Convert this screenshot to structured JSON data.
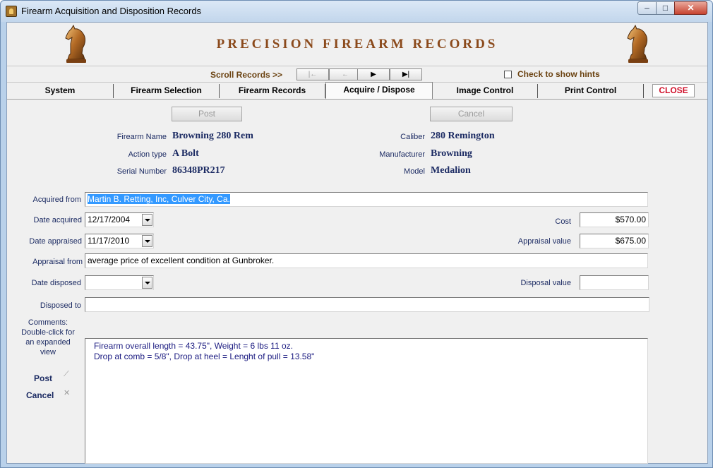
{
  "window": {
    "title": "Firearm Acquisition and Disposition Records",
    "min_glyph": "‒",
    "max_glyph": "□",
    "close_glyph": "✕"
  },
  "header": {
    "brand_title": "PRECISION FIREARM RECORDS",
    "scroll_label": "Scroll  Records >>",
    "nav": {
      "first": "|←",
      "prev": "←",
      "next": "▶",
      "last": "▶|"
    },
    "hints_label": "Check to show hints",
    "hints_checked": false
  },
  "tabs": [
    {
      "label": "System"
    },
    {
      "label": "Firearm Selection"
    },
    {
      "label": "Firearm Records"
    },
    {
      "label": "Acquire / Dispose",
      "active": true
    },
    {
      "label": "Image Control"
    },
    {
      "label": "Print Control"
    }
  ],
  "close_label": "CLOSE",
  "actions": {
    "post": "Post",
    "cancel": "Cancel"
  },
  "firearm": {
    "name_label": "Firearm Name",
    "name": "Browning 280 Rem",
    "action_label": "Action type",
    "action": "A Bolt",
    "serial_label": "Serial Number",
    "serial": "86348PR217",
    "caliber_label": "Caliber",
    "caliber": "280 Remington",
    "manufacturer_label": "Manufacturer",
    "manufacturer": "Browning",
    "model_label": "Model",
    "model": "Medalion"
  },
  "form": {
    "acquired_from_label": "Acquired from",
    "acquired_from": "Martin B. Retting, Inc, Culver City, Ca.",
    "date_acquired_label": "Date acquired",
    "date_acquired": "12/17/2004",
    "cost_label": "Cost",
    "cost": "$570.00",
    "date_appraised_label": "Date appraised",
    "date_appraised": "11/17/2010",
    "appraisal_value_label": "Appraisal value",
    "appraisal_value": "$675.00",
    "appraisal_from_label": "Appraisal from",
    "appraisal_from": "average price of excellent condition at Gunbroker.",
    "date_disposed_label": "Date disposed",
    "date_disposed": "",
    "disposal_value_label": "Disposal value",
    "disposal_value": "",
    "disposed_to_label": "Disposed to",
    "disposed_to": "",
    "comments_label_1": "Comments:",
    "comments_label_2": "Double-click for",
    "comments_label_3": "an expanded",
    "comments_label_4": "view",
    "comments_line_1": "Firearm overall length = 43.75\", Weight = 6 lbs 11 oz.",
    "comments_line_2": "Drop at comb = 5/8\", Drop at heel =   Lenght of pull = 13.58\""
  },
  "side": {
    "post": "Post",
    "cancel": "Cancel"
  },
  "colors": {
    "brand": "#8b4a1c",
    "label_navy": "#1c2b63",
    "close_red": "#d0102a",
    "selection": "#3399ff"
  }
}
